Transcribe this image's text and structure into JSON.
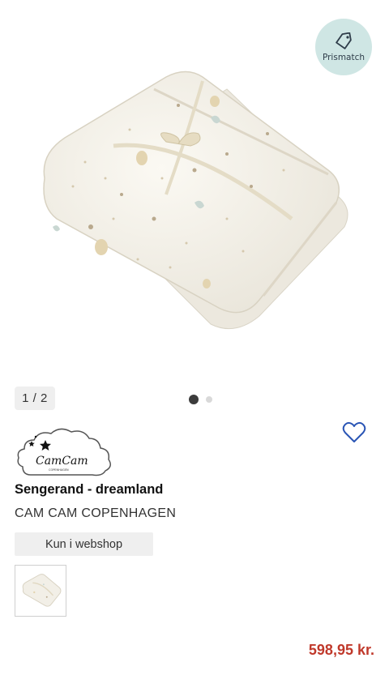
{
  "gallery": {
    "image_alt": "Sengerand - dreamland",
    "prismatch_label": "Prismatch",
    "counter": "1 / 2",
    "slide_count": 2,
    "active_slide": 1
  },
  "brand_logo": {
    "script_text": "CamCam",
    "sub_text": "COPENHAGEN"
  },
  "product": {
    "title": "Sengerand - dreamland",
    "brand": "CAM CAM COPENHAGEN",
    "availability": "Kun i webshop",
    "price": "598,95 kr."
  },
  "colors": {
    "price": "#c0392b",
    "prismatch_bg": "#cfe6e4",
    "heart": "#2a55b5",
    "badge_bg": "#efefef"
  },
  "icons": {
    "prismatch": "price-tag-icon",
    "favorite": "heart-outline-icon"
  }
}
